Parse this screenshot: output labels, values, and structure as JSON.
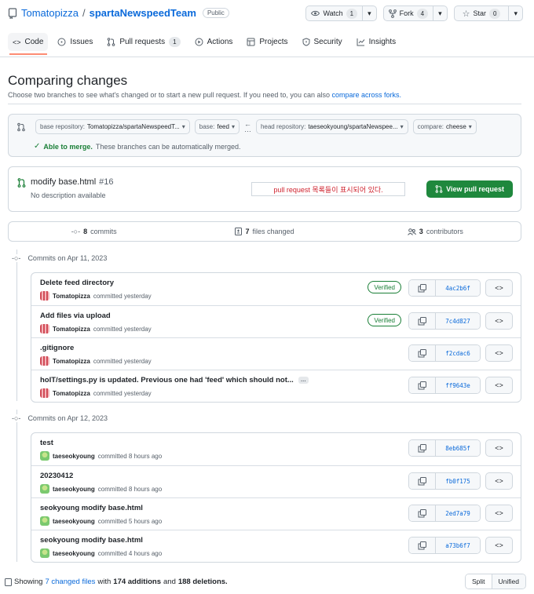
{
  "repo": {
    "owner": "Tomatopizza",
    "separator": "/",
    "name": "spartaNewspeedTeam",
    "visibility": "Public"
  },
  "actions": {
    "watch": {
      "label": "Watch",
      "count": "1"
    },
    "fork": {
      "label": "Fork",
      "count": "4"
    },
    "star": {
      "label": "Star",
      "count": "0"
    }
  },
  "tabs": [
    {
      "label": "Code",
      "icon": "code-icon"
    },
    {
      "label": "Issues",
      "icon": "issue-icon"
    },
    {
      "label": "Pull requests",
      "icon": "pull-request-icon",
      "count": "1"
    },
    {
      "label": "Actions",
      "icon": "play-icon"
    },
    {
      "label": "Projects",
      "icon": "table-icon"
    },
    {
      "label": "Security",
      "icon": "shield-icon"
    },
    {
      "label": "Insights",
      "icon": "graph-icon"
    }
  ],
  "compare": {
    "title": "Comparing changes",
    "subtitle": "Choose two branches to see what's changed or to start a new pull request. If you need to, you can also",
    "subtitle_link": "compare across forks.",
    "base_repo_label": "base repository:",
    "base_repo_value": "Tomatopizza/spartaNewspeedT...",
    "base_label": "base:",
    "base_value": "feed",
    "head_repo_label": "head repository:",
    "head_repo_value": "taeseokyoung/spartaNewspee...",
    "compare_label": "compare:",
    "compare_value": "cheese",
    "merge_status": "Able to merge.",
    "merge_text": "These branches can be automatically merged."
  },
  "pr": {
    "title": "modify base.html",
    "number": "#16",
    "description": "No description available",
    "note": "pull request 목록들이 표시되어 있다.",
    "view_button": "View pull request"
  },
  "stats": {
    "commits_count": "8",
    "commits_label": "commits",
    "files_count": "7",
    "files_label": "files changed",
    "contributors_count": "3",
    "contributors_label": "contributors"
  },
  "days": [
    {
      "header": "Commits on Apr 11, 2023",
      "commits": [
        {
          "message": "Delete feed directory",
          "author": "Tomatopizza",
          "time": "committed yesterday",
          "verified": "Verified",
          "sha": "4ac2b6f",
          "avatar": "tomato"
        },
        {
          "message": "Add files via upload",
          "author": "Tomatopizza",
          "time": "committed yesterday",
          "verified": "Verified",
          "sha": "7c4d827",
          "avatar": "tomato"
        },
        {
          "message": ".gitignore",
          "author": "Tomatopizza",
          "time": "committed yesterday",
          "verified": "",
          "sha": "f2cdac6",
          "avatar": "tomato"
        },
        {
          "message": "hoIT/settings.py is updated. Previous one had 'feed' which should not...",
          "author": "Tomatopizza",
          "time": "committed yesterday",
          "verified": "",
          "sha": "ff9643e",
          "avatar": "tomato",
          "ellipsis": "…"
        }
      ]
    },
    {
      "header": "Commits on Apr 12, 2023",
      "commits": [
        {
          "message": "test",
          "author": "taeseokyoung",
          "time": "committed 8 hours ago",
          "verified": "",
          "sha": "8eb685f",
          "avatar": "green"
        },
        {
          "message": "20230412",
          "author": "taeseokyoung",
          "time": "committed 8 hours ago",
          "verified": "",
          "sha": "fb0f175",
          "avatar": "green"
        },
        {
          "message": "seokyoung modify base.html",
          "author": "taeseokyoung",
          "time": "committed 5 hours ago",
          "verified": "",
          "sha": "2ed7a79",
          "avatar": "green"
        },
        {
          "message": "seokyoung modify base.html",
          "author": "taeseokyoung",
          "time": "committed 4 hours ago",
          "verified": "",
          "sha": "a73b6f7",
          "avatar": "green"
        }
      ]
    }
  ],
  "footer": {
    "showing": "Showing",
    "changed_files": "7 changed files",
    "with": "with",
    "additions": "174 additions",
    "and": "and",
    "deletions": "188 deletions.",
    "split": "Split",
    "unified": "Unified"
  },
  "colors": {
    "accent": "#0969da",
    "success": "#1f883d",
    "note_text": "#cf222e",
    "tab_underline": "#fd8c73"
  }
}
